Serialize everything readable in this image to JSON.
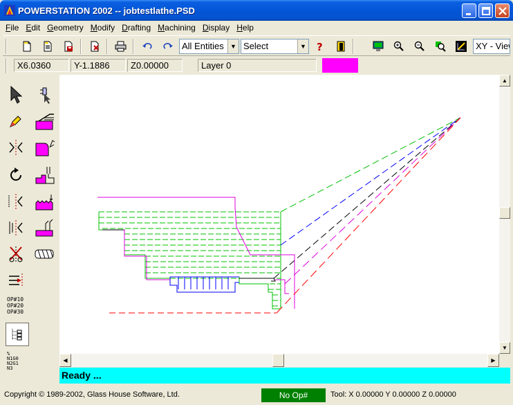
{
  "window": {
    "title": "POWERSTATION 2002 -- jobtestlathe.PSD",
    "controls": [
      "minimize",
      "maximize",
      "close"
    ]
  },
  "menu": [
    {
      "label": "File",
      "accel": "F"
    },
    {
      "label": "Edit",
      "accel": "E"
    },
    {
      "label": "Geometry",
      "accel": "G"
    },
    {
      "label": "Modify",
      "accel": "M"
    },
    {
      "label": "Drafting",
      "accel": "D"
    },
    {
      "label": "Machining",
      "accel": "M"
    },
    {
      "label": "Display",
      "accel": "D"
    },
    {
      "label": "Help",
      "accel": "H"
    }
  ],
  "toolbar": {
    "filter_combo": "All Entities",
    "select_combo": "Select",
    "view_combo": "XY - View"
  },
  "coords": {
    "x": "X6.0360",
    "y": "Y-1.1886",
    "z": "Z0.00000",
    "layer": "Layer 0",
    "color": "#ff00ff"
  },
  "palette": {
    "op_label_lines": [
      "OP#10",
      "OP#20",
      "OP#30"
    ],
    "nc_label_lines": [
      "%",
      "N1G0",
      "N2G1",
      "N3"
    ]
  },
  "canvas": {
    "colors": {
      "green": "#00c000",
      "blue": "#0000ff",
      "black": "#000000",
      "magenta": "#e000e0",
      "red": "#ff0000"
    }
  },
  "ready_text": "Ready ...",
  "status": {
    "copyright": "Copyright © 1989-2002, Glass House Software, Ltd.",
    "op": "No Op#",
    "tool": "Tool: X 0.00000 Y 0.00000 Z 0.00000"
  }
}
